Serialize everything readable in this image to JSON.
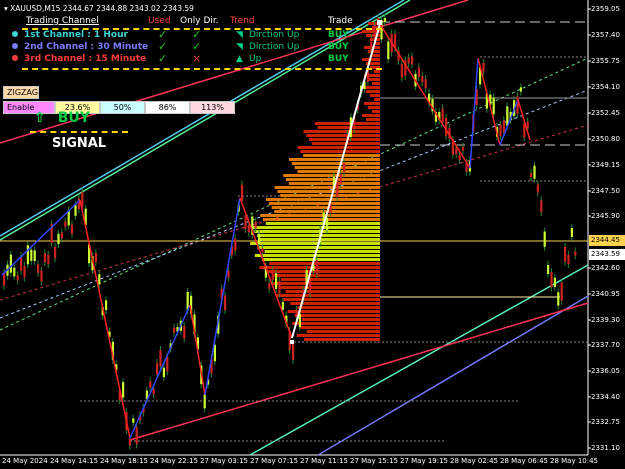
{
  "symbol_bar": {
    "text": "XAUUSD,M15  2344.67 2344.88 2343.02 2343.59"
  },
  "panel": {
    "headers": {
      "channel": "Trading Channel",
      "used": "Used",
      "only_dir": "Only Dir.",
      "trend": "Trend",
      "trade": "Trade"
    },
    "rows": [
      {
        "label": "1st Channel  : 1 Hour",
        "dot_color": "#3cd4d4",
        "text_color": "#3cd4d4",
        "used": "✓",
        "used_color": "#22cc22",
        "only": "✓",
        "only_color": "#22cc22",
        "trend_icon": "◥",
        "trend_text": "Dirction Up",
        "trade": "BUY"
      },
      {
        "label": "2nd Channel : 30 Minute",
        "dot_color": "#7b7bff",
        "text_color": "#7b7bff",
        "used": "✓",
        "used_color": "#22cc22",
        "only": "✓",
        "only_color": "#22cc22",
        "trend_icon": "◥",
        "trend_text": "Dirction Up",
        "trade": "BUY"
      },
      {
        "label": "3rd Channel  : 15 Minute",
        "dot_color": "#ff3b3b",
        "text_color": "#ff3b3b",
        "used": "✓",
        "used_color": "#22cc22",
        "only": "×",
        "only_color": "#ff3b3b",
        "trend_icon": "▲",
        "trend_text": "Up",
        "trade": "BUY"
      }
    ]
  },
  "zigzag_button": {
    "label": "ZIGZAG"
  },
  "fibo": {
    "enable_label": "Enable Fbo",
    "levels": [
      "23.6%",
      "50%",
      "86%",
      "113%"
    ]
  },
  "signal": {
    "word": "BUY",
    "label": "SIGNAL"
  },
  "price_axis": {
    "labels": [
      "2359.05",
      "2357.40",
      "2355.75",
      "2354.10",
      "2352.45",
      "2350.80",
      "2349.15",
      "2347.50",
      "2345.90",
      "2342.60",
      "2340.95",
      "2339.30",
      "2337.70",
      "2336.05",
      "2334.40",
      "2332.75",
      "2331.10"
    ],
    "current_price": "2344.45",
    "bid_price": "2343.59"
  },
  "time_axis": {
    "labels": [
      "24 May 2024",
      "24 May 14:15",
      "24 May 18:15",
      "24 May 22:15",
      "27 May 03:15",
      "27 May 07:15",
      "27 May 11:15",
      "27 May 15:15",
      "27 May 19:15",
      "28 May 02:45",
      "28 May 06:45",
      "28 May 10:45"
    ]
  },
  "colors": {
    "background": "#000000",
    "bull_candle": "#ccff33",
    "bear_candle": "#cc2222",
    "zigzag_up": "#3344ff",
    "zigzag_down": "#ff2222",
    "current_price_line": "#ffd24d",
    "profile_orange": "#e07a00",
    "profile_red": "#cc2200",
    "profile_yellowgreen": "#c8e000"
  }
}
